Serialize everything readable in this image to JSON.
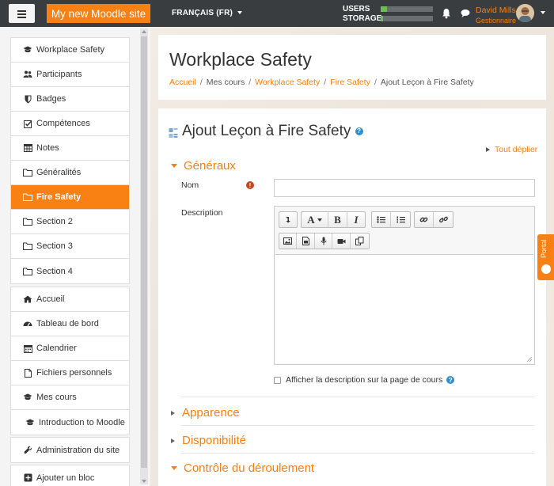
{
  "navbar": {
    "site_name": "My new Moodle site",
    "language": "FRANÇAIS (FR)",
    "usage": [
      {
        "label": "USERS",
        "fill_percent": 12
      },
      {
        "label": "STORAGE",
        "fill_percent": 5
      }
    ],
    "user_name": "David Mills",
    "user_role": "Gestionnaire"
  },
  "sidebar": {
    "course_nav": [
      {
        "label": "Workplace Safety",
        "icon": "graduation-cap-icon"
      },
      {
        "label": "Participants",
        "icon": "users-icon"
      },
      {
        "label": "Badges",
        "icon": "shield-icon"
      },
      {
        "label": "Compétences",
        "icon": "checkbox-icon"
      },
      {
        "label": "Notes",
        "icon": "table-icon"
      },
      {
        "label": "Généralités",
        "icon": "folder-icon"
      },
      {
        "label": "Fire Safety",
        "icon": "folder-icon",
        "active": true
      },
      {
        "label": "Section 2",
        "icon": "folder-icon"
      },
      {
        "label": "Section 3",
        "icon": "folder-icon"
      },
      {
        "label": "Section 4",
        "icon": "folder-icon"
      }
    ],
    "site_nav": [
      {
        "label": "Accueil",
        "icon": "home-icon"
      },
      {
        "label": "Tableau de bord",
        "icon": "dashboard-icon"
      },
      {
        "label": "Calendrier",
        "icon": "calendar-icon"
      },
      {
        "label": "Fichiers personnels",
        "icon": "file-icon"
      },
      {
        "label": "Mes cours",
        "icon": "graduation-cap-icon"
      },
      {
        "label": "Introduction to Moodle",
        "icon": "graduation-cap-icon"
      }
    ],
    "admin": {
      "label": "Administration du site",
      "icon": "wrench-icon"
    },
    "add_block": {
      "label": "Ajouter un bloc",
      "icon": "plus-square-icon"
    }
  },
  "header": {
    "title": "Workplace Safety",
    "breadcrumb": [
      {
        "label": "Accueil",
        "link": true
      },
      {
        "label": "Mes cours",
        "link": false
      },
      {
        "label": "Workplace Safety",
        "link": true
      },
      {
        "label": "Fire Safety",
        "link": true
      },
      {
        "label": "Ajout Leçon à Fire Safety",
        "link": false
      }
    ]
  },
  "form": {
    "title": "Ajout Leçon à Fire Safety",
    "expand_all": "Tout déplier",
    "sections": {
      "general": "Généraux",
      "appearance": "Apparence",
      "availability": "Disponibilité",
      "flow": "Contrôle du déroulement"
    },
    "name_label": "Nom",
    "name_value": "",
    "description_label": "Description",
    "show_description_label": "Afficher la description sur la page de cours",
    "toolbar_row1": [
      "collapse-toggle-icon",
      "font-style-icon",
      "bold-icon",
      "italic-icon",
      "bullet-list-icon",
      "numbered-list-icon",
      "link-icon",
      "unlink-icon"
    ],
    "toolbar_row2": [
      "image-icon",
      "media-icon",
      "microphone-icon",
      "video-icon",
      "manage-files-icon"
    ],
    "bold_glyph": "B",
    "italic_glyph": "I",
    "font_glyph": "A"
  },
  "portal_tab": {
    "label": "Portal"
  },
  "colors": {
    "accent": "#f98012",
    "navbar": "#393d40",
    "help": "#2f8fc9",
    "required": "#c4471d"
  }
}
